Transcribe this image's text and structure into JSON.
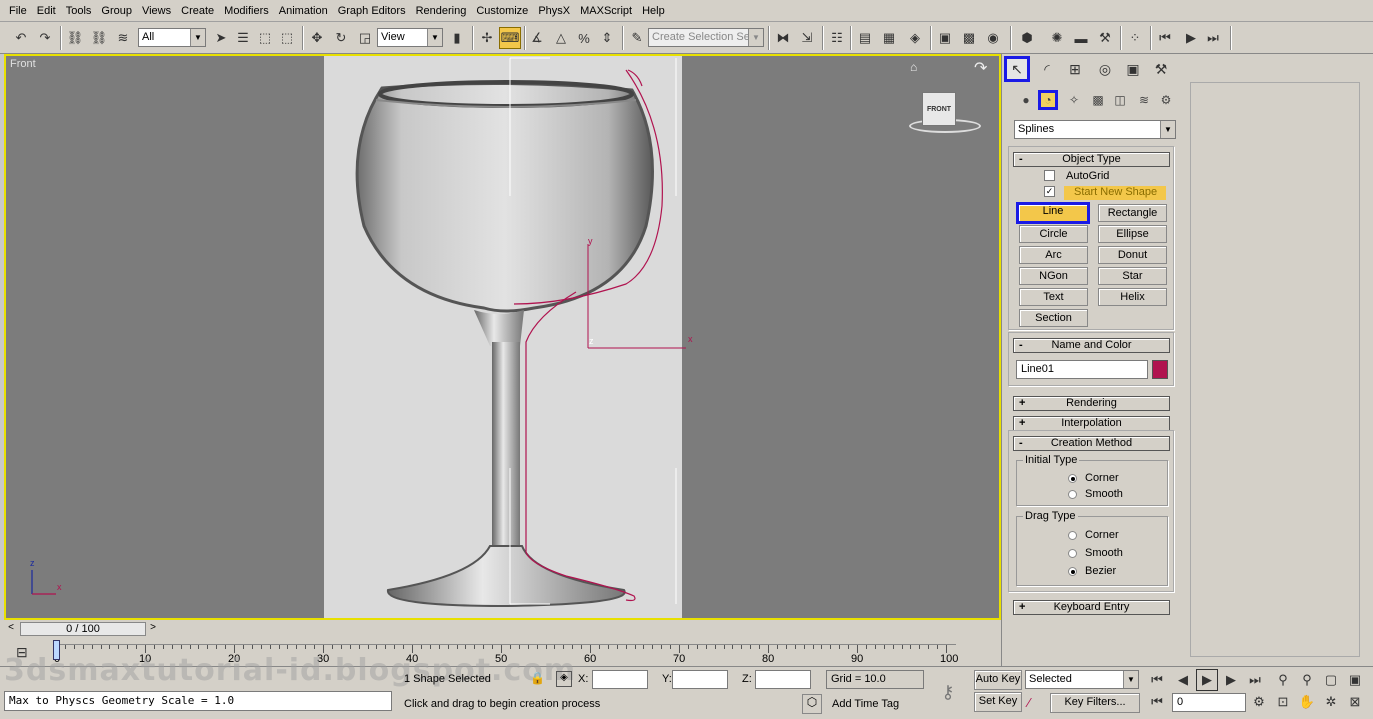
{
  "menu": [
    "File",
    "Edit",
    "Tools",
    "Group",
    "Views",
    "Create",
    "Modifiers",
    "Animation",
    "Graph Editors",
    "Rendering",
    "Customize",
    "PhysX",
    "MAXScript",
    "Help"
  ],
  "toolbar": {
    "filter_value": "All",
    "coord_value": "View",
    "selection_set_placeholder": "Create Selection Set"
  },
  "viewport": {
    "label": "Front",
    "navcube_label": "FRONT",
    "axis_y": "y",
    "axis_x": "x",
    "axis_z": "z",
    "corner_z": "z",
    "corner_x": "x"
  },
  "command_panel": {
    "category_value": "Splines",
    "object_type": {
      "header": "Object Type",
      "autogrid_label": "AutoGrid",
      "autogrid_checked": false,
      "start_new_shape_label": "Start New Shape",
      "start_new_shape_checked": true,
      "buttons": [
        "Line",
        "Rectangle",
        "Circle",
        "Ellipse",
        "Arc",
        "Donut",
        "NGon",
        "Star",
        "Text",
        "Helix",
        "Section"
      ]
    },
    "name_color": {
      "header": "Name and Color",
      "name_value": "Line01",
      "color": "#b0134f"
    },
    "rendering_header": "Rendering",
    "interpolation_header": "Interpolation",
    "creation_method": {
      "header": "Creation Method",
      "initial_type_label": "Initial Type",
      "initial_options": [
        "Corner",
        "Smooth"
      ],
      "initial_selected": "Corner",
      "drag_type_label": "Drag Type",
      "drag_options": [
        "Corner",
        "Smooth",
        "Bezier"
      ],
      "drag_selected": "Bezier"
    },
    "keyboard_entry_header": "Keyboard Entry"
  },
  "timeline": {
    "frame_display": "0 / 100",
    "ticks": [
      "0",
      "10",
      "20",
      "30",
      "40",
      "50",
      "60",
      "70",
      "80",
      "90",
      "100"
    ]
  },
  "status": {
    "selection_count": "1 Shape Selected",
    "prompt": "Click and drag to begin creation process",
    "maxscript_output": "Max to Physcs Geometry Scale = 1.0",
    "x_label": "X:",
    "y_label": "Y:",
    "z_label": "Z:",
    "grid": "Grid = 10.0",
    "add_time_tag": "Add Time Tag",
    "auto_key": "Auto Key",
    "set_key": "Set Key",
    "key_mode_value": "Selected",
    "key_filters": "Key Filters...",
    "current_frame": "0"
  },
  "watermark": "3dsmaxtutorial-id.blogspot.com",
  "colors": {
    "spline": "#b0134f",
    "highlight": "#f3c74a",
    "focus_border": "#1a1ae6",
    "viewport_border": "#e8e000"
  }
}
